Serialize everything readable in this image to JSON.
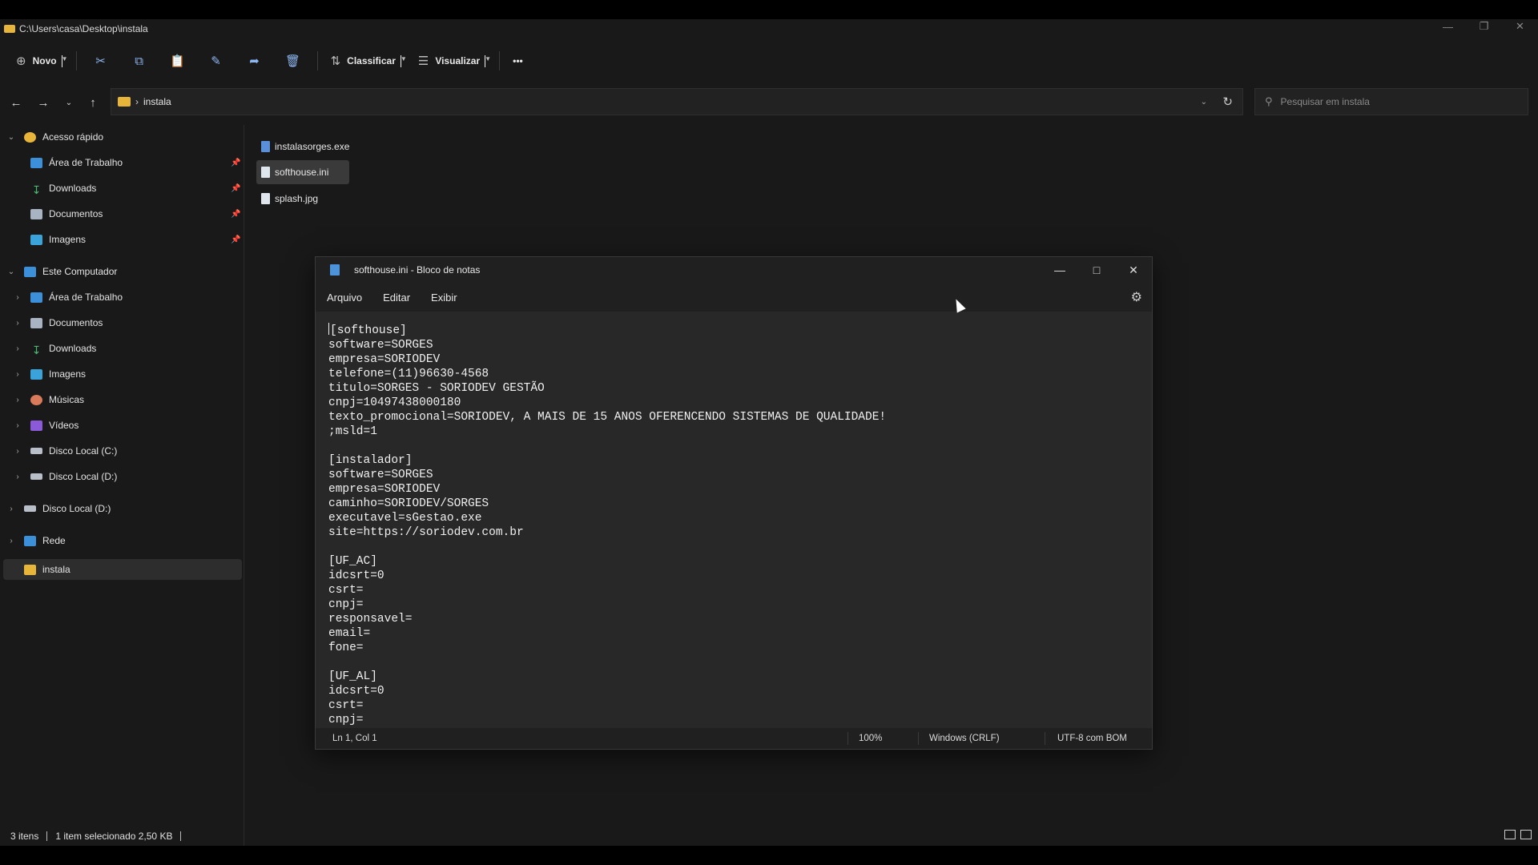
{
  "explorer": {
    "title_path": "C:\\Users\\casa\\Desktop\\instala",
    "window_controls": [
      "minimize-icon",
      "restore-icon",
      "close-icon"
    ],
    "toolbar": {
      "new_label": "Novo",
      "sort_label": "Classificar",
      "view_label": "Visualizar",
      "more_label": "•••"
    },
    "address": {
      "crumb": "instala",
      "search_placeholder": "Pesquisar em instala"
    },
    "sidebar": {
      "quick_access": "Acesso rápido",
      "quick_items": [
        "Área de Trabalho",
        "Downloads",
        "Documentos",
        "Imagens"
      ],
      "this_pc": "Este Computador",
      "pc_items": [
        "Área de Trabalho",
        "Documentos",
        "Downloads",
        "Imagens",
        "Músicas",
        "Vídeos",
        "Disco Local (C:)",
        "Disco Local (D:)"
      ],
      "disk_d": "Disco Local (D:)",
      "network": "Rede",
      "selected_folder": "instala"
    },
    "files": [
      "instalasorges.exe",
      "softhouse.ini",
      "splash.jpg"
    ],
    "status": {
      "count": "3 itens",
      "selection": "1 item selecionado  2,50 KB"
    }
  },
  "notepad": {
    "title": "softhouse.ini - Bloco de notas",
    "menu": [
      "Arquivo",
      "Editar",
      "Exibir"
    ],
    "content": "[softhouse]\nsoftware=SORGES\nempresa=SORIODEV\ntelefone=(11)96630-4568\ntitulo=SORGES - SORIODEV GESTÃO\ncnpj=10497438000180\ntexto_promocional=SORIODEV, A MAIS DE 15 ANOS OFERENCENDO SISTEMAS DE QUALIDADE!\n;msld=1\n\n[instalador]\nsoftware=SORGES\nempresa=SORIODEV\ncaminho=SORIODEV/SORGES\nexecutavel=sGestao.exe\nsite=https://soriodev.com.br\n\n[UF_AC]\nidcsrt=0\ncsrt=\ncnpj=\nresponsavel=\nemail=\nfone=\n\n[UF_AL]\nidcsrt=0\ncsrt=\ncnpj=",
    "status": {
      "position": "Ln 1, Col 1",
      "zoom": "100%",
      "line_ending": "Windows (CRLF)",
      "encoding": "UTF-8 com BOM"
    }
  }
}
